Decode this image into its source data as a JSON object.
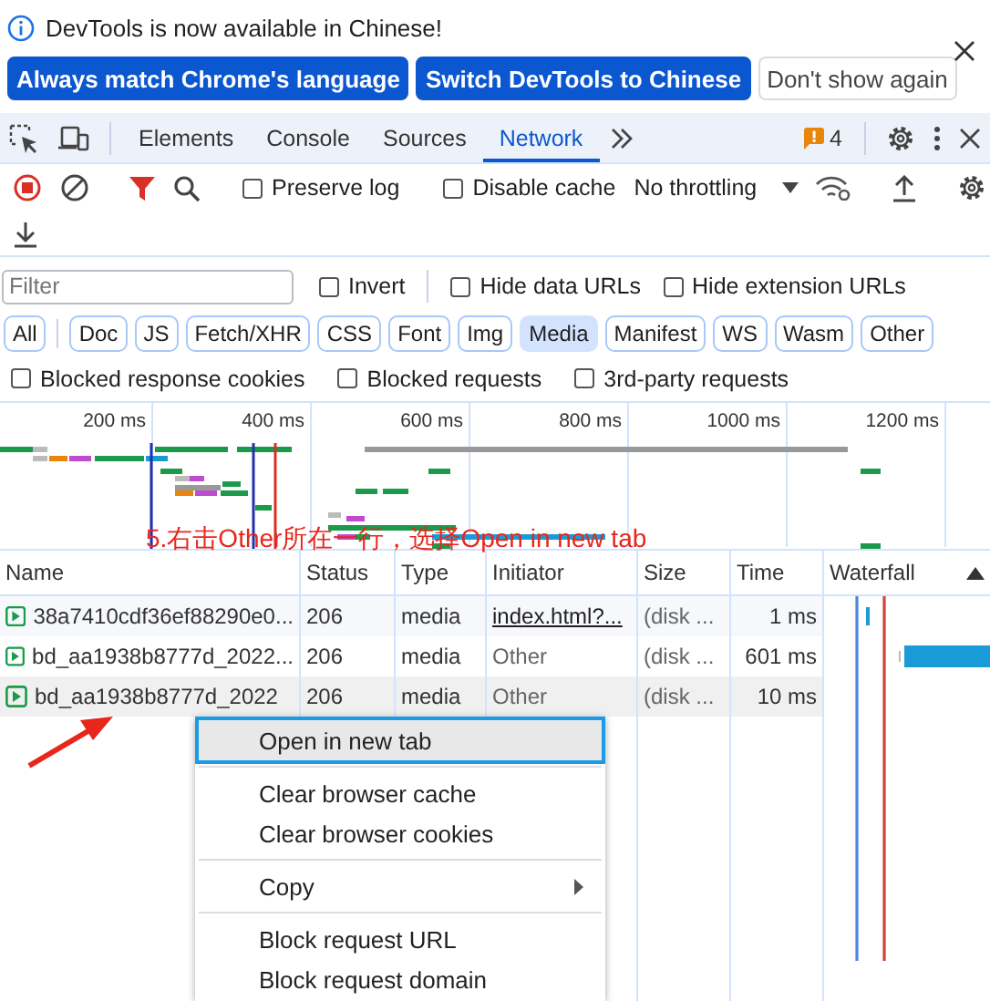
{
  "infobar": {
    "message": "DevTools is now available in Chinese!",
    "buttons": [
      {
        "label": "Always match Chrome's language",
        "kind": "primary"
      },
      {
        "label": "Switch DevTools to Chinese",
        "kind": "primary"
      },
      {
        "label": "Don't show again",
        "kind": "secondary"
      }
    ]
  },
  "tabs": [
    {
      "label": "Elements",
      "selected": false
    },
    {
      "label": "Console",
      "selected": false
    },
    {
      "label": "Sources",
      "selected": false
    },
    {
      "label": "Network",
      "selected": true
    }
  ],
  "issues_count": "4",
  "toolbar": {
    "recording": true,
    "checkboxes": [
      {
        "label": "Preserve log",
        "checked": false
      },
      {
        "label": "Disable cache",
        "checked": false
      }
    ],
    "throttling": "No throttling"
  },
  "filter": {
    "placeholder": "Filter",
    "options": [
      {
        "label": "Invert",
        "checked": false
      },
      {
        "label": "Hide data URLs",
        "checked": false
      },
      {
        "label": "Hide extension URLs",
        "checked": false
      }
    ]
  },
  "type_filters": [
    {
      "label": "All",
      "selected": false
    },
    {
      "label": "Doc",
      "selected": false
    },
    {
      "label": "JS",
      "selected": false
    },
    {
      "label": "Fetch/XHR",
      "selected": false
    },
    {
      "label": "CSS",
      "selected": false
    },
    {
      "label": "Font",
      "selected": false
    },
    {
      "label": "Img",
      "selected": false
    },
    {
      "label": "Media",
      "selected": true
    },
    {
      "label": "Manifest",
      "selected": false
    },
    {
      "label": "WS",
      "selected": false
    },
    {
      "label": "Wasm",
      "selected": false
    },
    {
      "label": "Other",
      "selected": false
    }
  ],
  "blocked_options": [
    {
      "label": "Blocked response cookies",
      "checked": false
    },
    {
      "label": "Blocked requests",
      "checked": false
    },
    {
      "label": "3rd-party requests",
      "checked": false
    }
  ],
  "overview": {
    "ticks": [
      "200 ms",
      "400 ms",
      "600 ms",
      "800 ms",
      "1000 ms",
      "1200 ms"
    ]
  },
  "annotation": {
    "text": "5.右击Other所在一行，选择Open in new tab"
  },
  "table": {
    "columns": [
      "Name",
      "Status",
      "Type",
      "Initiator",
      "Size",
      "Time",
      "Waterfall"
    ],
    "rows": [
      {
        "name": "38a7410cdf36ef88290e0...",
        "status": "206",
        "type": "media",
        "initiator": "index.html?...",
        "initiator_link": true,
        "size": "(disk ...",
        "time": "1 ms"
      },
      {
        "name": "bd_aa1938b8777d_2022...",
        "status": "206",
        "type": "media",
        "initiator": "Other",
        "initiator_link": false,
        "size": "(disk ...",
        "time": "601 ms"
      },
      {
        "name": "bd_aa1938b8777d_2022",
        "status": "206",
        "type": "media",
        "initiator": "Other",
        "initiator_link": false,
        "size": "(disk ...",
        "time": "10 ms"
      }
    ]
  },
  "context_menu": {
    "groups": [
      [
        {
          "label": "Open in new tab",
          "selected": true,
          "submenu": false
        }
      ],
      [
        {
          "label": "Clear browser cache",
          "selected": false,
          "submenu": false
        },
        {
          "label": "Clear browser cookies",
          "selected": false,
          "submenu": false
        }
      ],
      [
        {
          "label": "Copy",
          "selected": false,
          "submenu": true
        }
      ],
      [
        {
          "label": "Block request URL",
          "selected": false,
          "submenu": false
        },
        {
          "label": "Block request domain",
          "selected": false,
          "submenu": false
        }
      ]
    ]
  }
}
